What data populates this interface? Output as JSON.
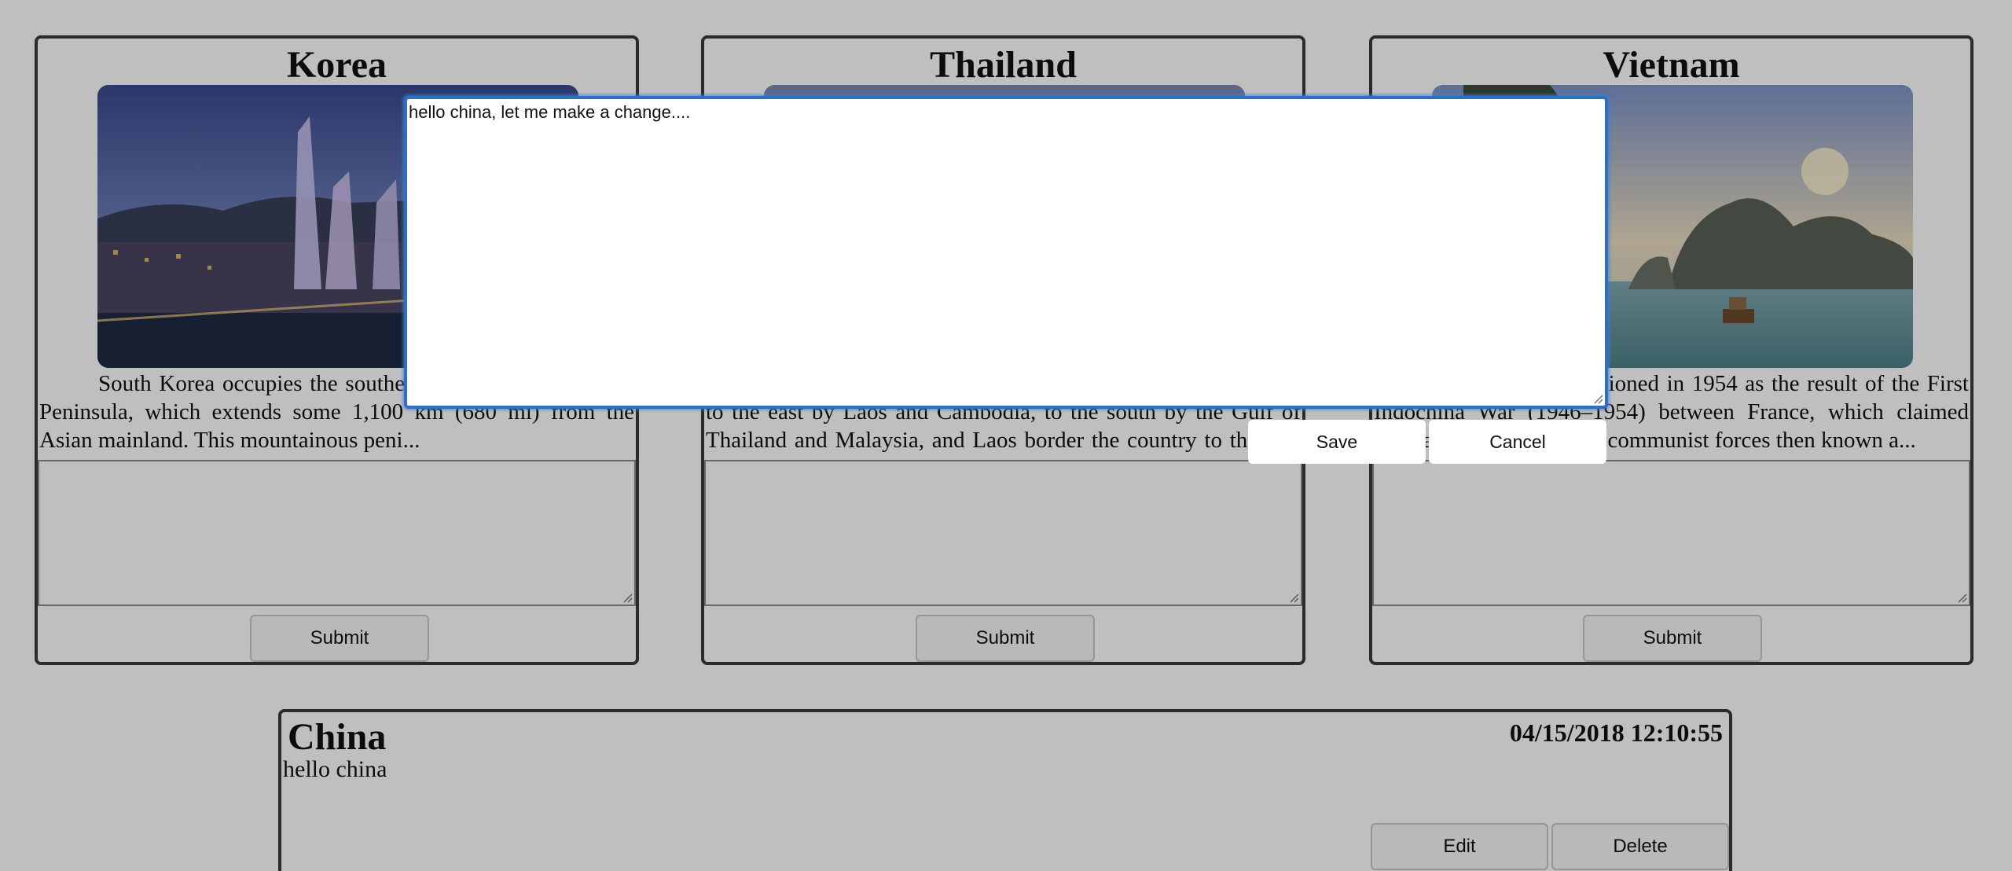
{
  "cards": [
    {
      "title": "Korea",
      "description": "South Korea occupies the southern portion of the Korean Peninsula, which extends some 1,100 km (680 mi) from the Asian mainland. This mountainous peni...",
      "submit_label": "Submit"
    },
    {
      "title": "Thailand",
      "description": "Thailand is bordered to the north by Myanmar and Laos, to the east by Laos and Cambodia, to the south by the Gulf of Thailand and Malaysia, and Laos border the country to the east and northeast, and Myanmar lies to the northwest. To the ...",
      "submit_label": "Submit"
    },
    {
      "title": "Vietnam",
      "description": "Vietnam was partitioned in 1954 as the result of the First Indochina War (1946–1954) between France, which claimed Vietnam as a colony, and communist forces then known a...",
      "submit_label": "Submit"
    }
  ],
  "post": {
    "country": "China",
    "date": "04/15/2018 12:10:55",
    "text": "hello china",
    "edit_label": "Edit",
    "delete_label": "Delete"
  },
  "edit_dialog": {
    "value": "hello china, let me make a change....",
    "save_label": "Save",
    "cancel_label": "Cancel"
  }
}
